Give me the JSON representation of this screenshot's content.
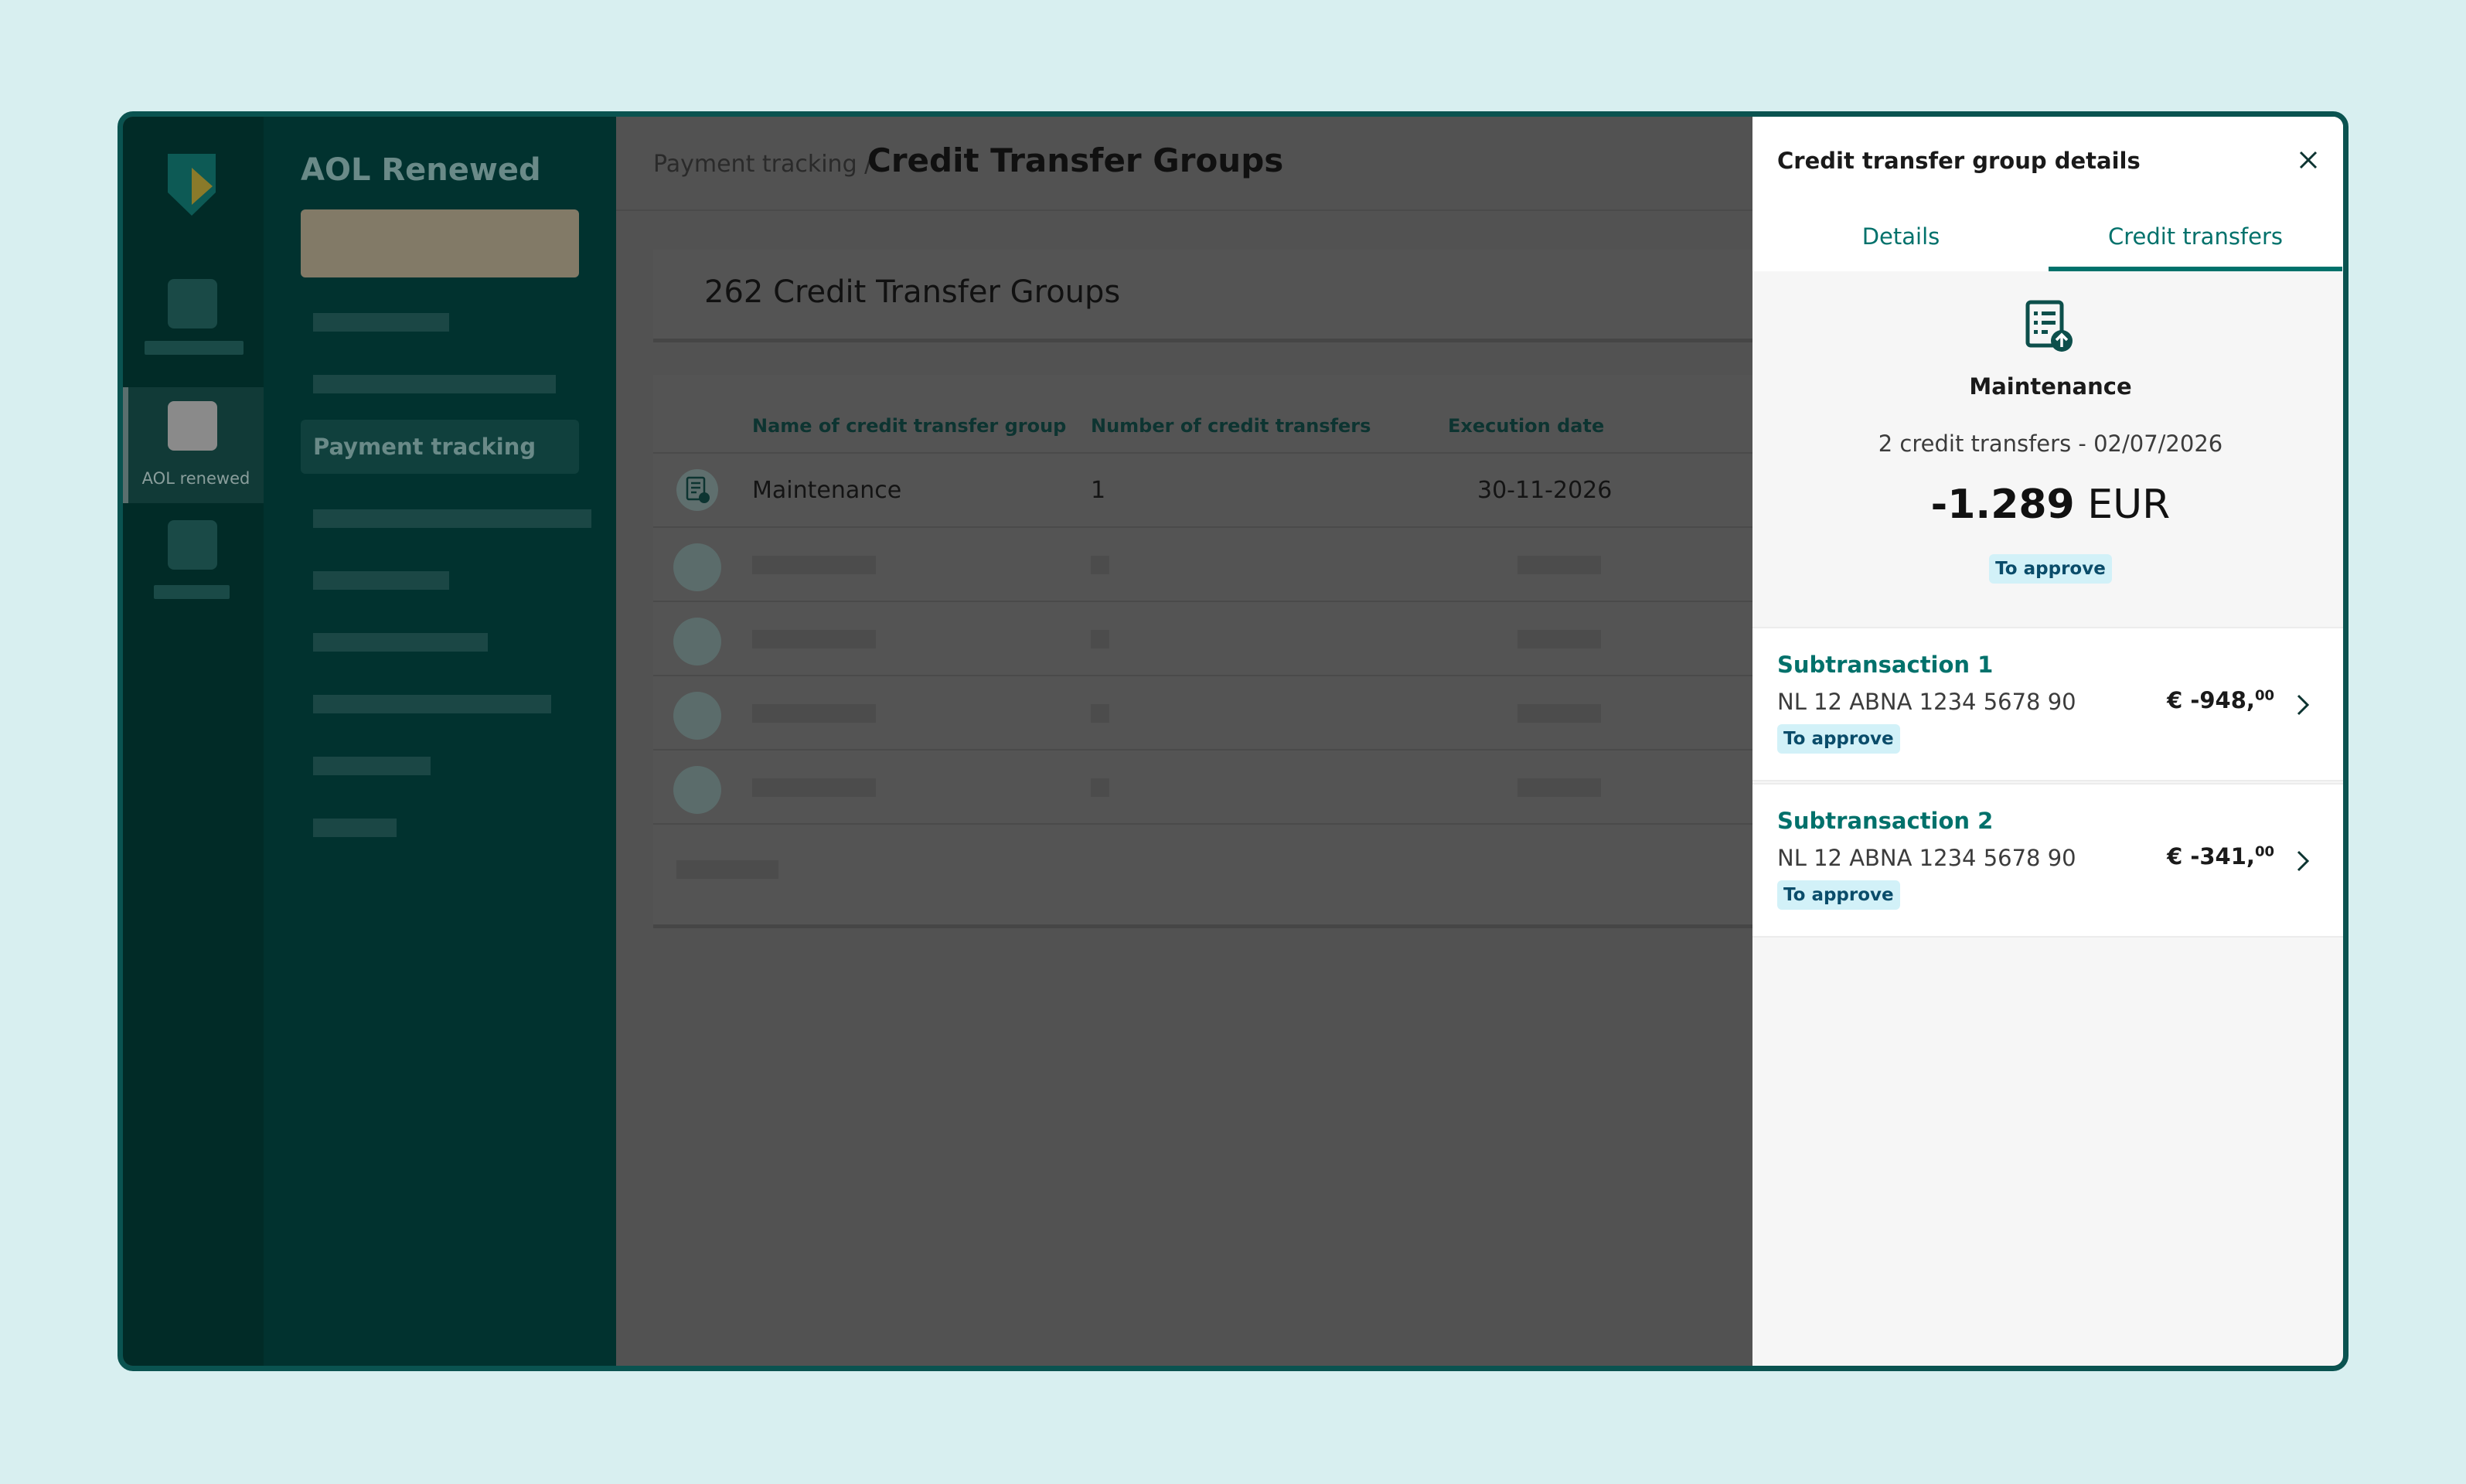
{
  "sidebar": {
    "app_title": "AOL Renewed",
    "active_rail_label": "AOL renewed",
    "active_item": "Payment tracking"
  },
  "header": {
    "breadcrumb": "Payment tracking /",
    "title": "Credit Transfer Groups"
  },
  "main": {
    "count_label": "262 Credit Transfer Groups",
    "columns": [
      "Name of credit transfer group",
      "Number of credit transfers",
      "Execution date"
    ],
    "rows": [
      {
        "name": "Maintenance",
        "count": "1",
        "date": "30-11-2026"
      }
    ]
  },
  "panel": {
    "title": "Credit transfer group details",
    "tabs": [
      "Details",
      "Credit transfers"
    ],
    "active_tab": "Credit transfers",
    "group_name": "Maintenance",
    "subtitle": "2 credit transfers - 02/07/2026",
    "total_amount": "-1.289",
    "currency": "EUR",
    "status": "To approve",
    "subtransactions": [
      {
        "title": "Subtransaction 1",
        "iban": "NL 12 ABNA 1234 5678 90",
        "amount_main": "€ -948,",
        "amount_cents": "00",
        "status": "To approve"
      },
      {
        "title": "Subtransaction 2",
        "iban": "NL 12 ABNA 1234 5678 90",
        "amount_main": "€ -341,",
        "amount_cents": "00",
        "status": "To approve"
      }
    ]
  },
  "colors": {
    "accent": "#00716b",
    "badge_bg": "#d2f1f8",
    "frame": "#0a5350",
    "background": "#d8eff0"
  }
}
